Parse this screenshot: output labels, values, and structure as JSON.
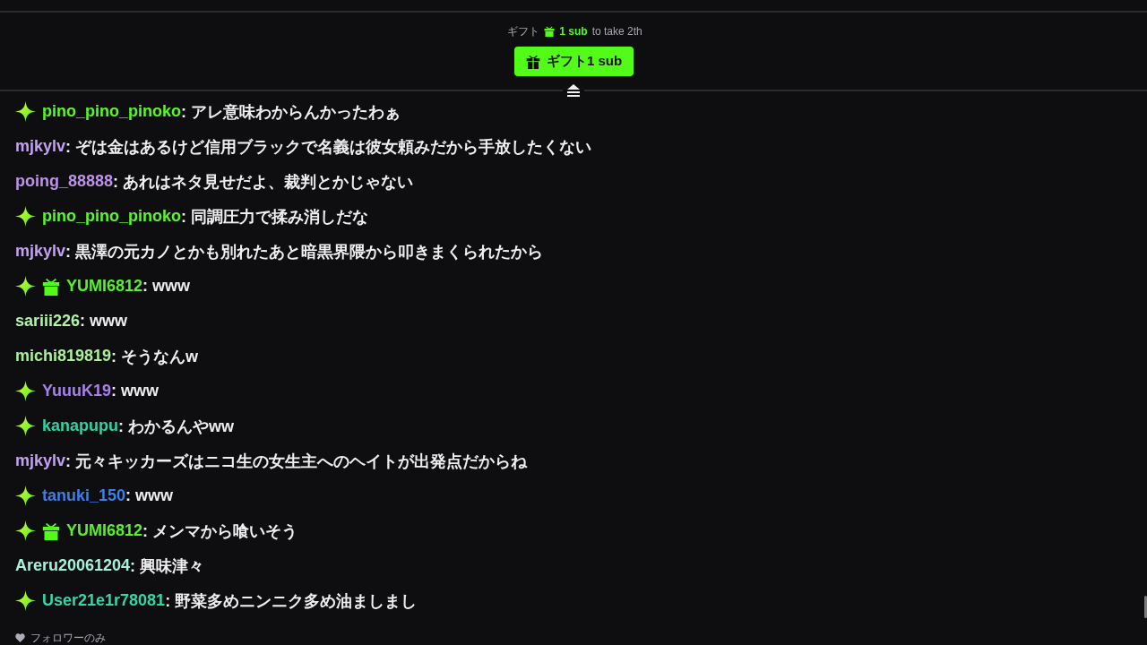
{
  "gift_prompt": {
    "prefix": "ギフト",
    "amount": "1 sub",
    "suffix": "to take 2th"
  },
  "gift_button": {
    "label": "ギフト1 sub"
  },
  "messages": [
    {
      "badges": [
        {
          "kind": "sparkle"
        }
      ],
      "username": "pino_pino_pinoko",
      "color": "#5cf52a",
      "text": ": アレ意味わからんかったわぁ"
    },
    {
      "username": "mjkylv",
      "color": "#c4a1f2",
      "text": ": ぞは金はあるけど信用ブラックで名義は彼女頼みだから手放したくない"
    },
    {
      "username": "poing_88888",
      "color": "#bd93e8",
      "text": ": あれはネタ見せだよ、裁判とかじゃない"
    },
    {
      "badges": [
        {
          "kind": "sparkle"
        }
      ],
      "username": "pino_pino_pinoko",
      "color": "#5cf52a",
      "text": ": 同調圧力で揉み消しだな"
    },
    {
      "username": "mjkylv",
      "color": "#c4a1f2",
      "text": ": 黒澤の元カノとかも別れたあと暗黒界隈から叩きまくられたから"
    },
    {
      "badges": [
        {
          "kind": "sparkle"
        },
        {
          "kind": "gift"
        }
      ],
      "username": "YUMI6812",
      "color": "#57f02b",
      "text": ": www"
    },
    {
      "username": "sariii226",
      "color": "#b2f2a6",
      "text": ": www"
    },
    {
      "username": "michi819819",
      "color": "#acee9a",
      "text": ": そうなんw"
    },
    {
      "badges": [
        {
          "kind": "sparkle"
        }
      ],
      "username": "YuuuK19",
      "color": "#a781e8",
      "text": ": www"
    },
    {
      "badges": [
        {
          "kind": "sparkle"
        }
      ],
      "username": "kanapupu",
      "color": "#2ed3a4",
      "text": ": わかるんやww"
    },
    {
      "username": "mjkylv",
      "color": "#c4a1f2",
      "text": ": 元々キッカーズはニコ生の女生主へのヘイトが出発点だからね"
    },
    {
      "badges": [
        {
          "kind": "sparkle"
        }
      ],
      "username": "tanuki_150",
      "color": "#3d7fe8",
      "text": ": www"
    },
    {
      "badges": [
        {
          "kind": "sparkle"
        },
        {
          "kind": "gift"
        }
      ],
      "username": "YUMI6812",
      "color": "#57f02b",
      "text": ": メンマから喰いそう"
    },
    {
      "username": "Areru20061204",
      "color": "#a6f1d8",
      "text": ": 興味津々"
    },
    {
      "badges": [
        {
          "kind": "sparkle"
        }
      ],
      "username": "User21e1r78081",
      "color": "#33d6a6",
      "text": ": 野菜多めニンニク多め油ましまし"
    }
  ],
  "footer": {
    "mode": "フォロワーのみ"
  }
}
